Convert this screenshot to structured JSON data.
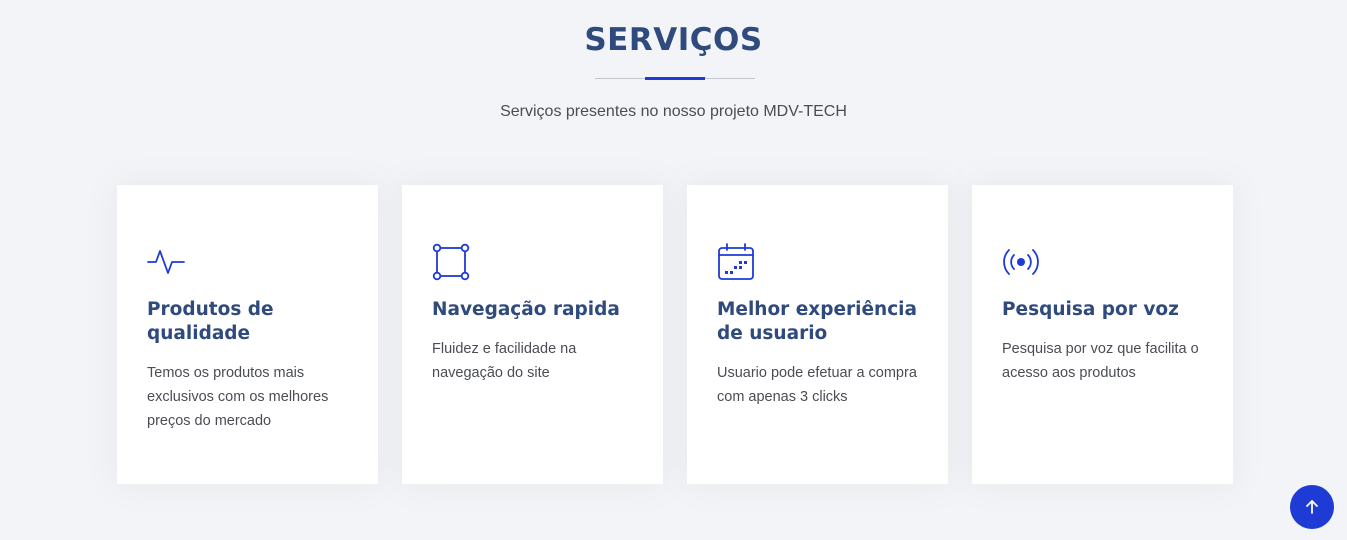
{
  "section": {
    "title": "SERVIÇOS",
    "subtitle": "Serviços presentes no nosso projeto MDV-TECH"
  },
  "colors": {
    "accent": "#1f3bd6",
    "heading": "#2f4a7c",
    "text": "#4a4d55",
    "background": "#f3f4f7"
  },
  "cards": [
    {
      "icon": "activity-icon",
      "title": "Produtos de qualidade",
      "text": "Temos os produtos mais exclusivos com os melhores preços do mercado"
    },
    {
      "icon": "bounding-box-icon",
      "title": "Navegação rapida",
      "text": "Fluidez e facilidade na navegação do site"
    },
    {
      "icon": "calendar-icon",
      "title": "Melhor experiência de usuario",
      "text": "Usuario pode efetuar a compra com apenas 3 clicks"
    },
    {
      "icon": "broadcast-icon",
      "title": "Pesquisa por voz",
      "text": "Pesquisa por voz que facilita o acesso aos produtos"
    }
  ],
  "back_to_top": {
    "icon": "arrow-up-icon"
  }
}
